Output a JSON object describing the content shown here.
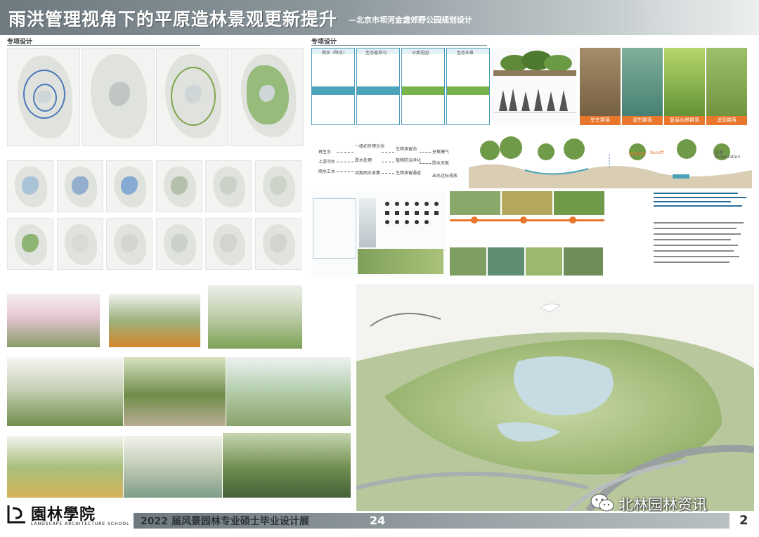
{
  "header": {
    "title": "雨洪管理视角下的平原造林景观更新提升",
    "subtitle": "—北京市坝河金盏郊野公园规划设计"
  },
  "sections": {
    "left_label": "专项设计",
    "right_label": "专项设计"
  },
  "forest_types": [
    {
      "label": "旱生群落",
      "color": "#e8762c"
    },
    {
      "label": "湿生群落",
      "color": "#e8762c"
    },
    {
      "label": "复层丛林群落",
      "color": "#e8762c"
    },
    {
      "label": "滨草群落",
      "color": "#e8762c"
    }
  ],
  "hydro_columns": [
    {
      "head": "雨水（降水）"
    },
    {
      "head": "生态植草沟"
    },
    {
      "head": "分类花园"
    },
    {
      "head": "生态水景"
    }
  ],
  "flow_chart": {
    "left": [
      "再生水",
      "上游河水",
      "雨水汇水"
    ],
    "middle": [
      "一级初步理沙池",
      "跌水处理",
      "初期雨水收集"
    ],
    "right": [
      "生物滞留池",
      "植物防治净化",
      "生物滞留通道"
    ],
    "far": [
      "充氧曝气",
      "跌水充氧",
      "出水达标排放"
    ]
  },
  "section_labels": {
    "runoff": "地表径流",
    "runoff_en": "Runoff",
    "evaporation": "蒸发",
    "evaporation_en": "Evaporation"
  },
  "footer": {
    "school_cn": "園林學院",
    "school_en": "LANDSCAPE ARCHITECTURE SCHOOL",
    "expo": "2022 届风景园林专业硕士毕业设计展",
    "number": "24",
    "page": "2"
  },
  "watermark": {
    "text": "北林园林资讯",
    "icon": "wechat-icon"
  },
  "colors": {
    "header": "#7d888d",
    "accent_orange": "#e8762c",
    "water_blue": "#4aa3b9",
    "green": "#77b34a"
  }
}
